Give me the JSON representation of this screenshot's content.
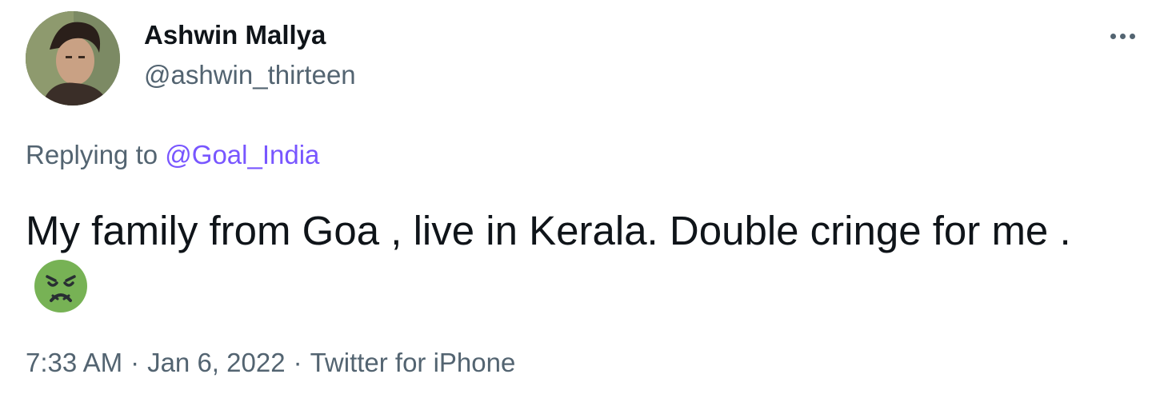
{
  "author": {
    "display_name": "Ashwin Mallya",
    "handle": "@ashwin_thirteen",
    "avatar_icon": "user-avatar-photo"
  },
  "more_icon": "ellipsis-icon",
  "reply": {
    "prefix": "Replying to",
    "mention": "@Goal_India"
  },
  "tweet": {
    "text": "My family from Goa , live in Kerala. Double cringe for me .",
    "emoji_icon": "nauseated-face-emoji"
  },
  "meta": {
    "time": "7:33 AM",
    "date": "Jan 6, 2022",
    "source": "Twitter for iPhone",
    "separator": "·"
  },
  "colors": {
    "primary_text": "#0f1419",
    "secondary_text": "#536471",
    "mention": "#7856ff",
    "emoji_green": "#77b255"
  }
}
